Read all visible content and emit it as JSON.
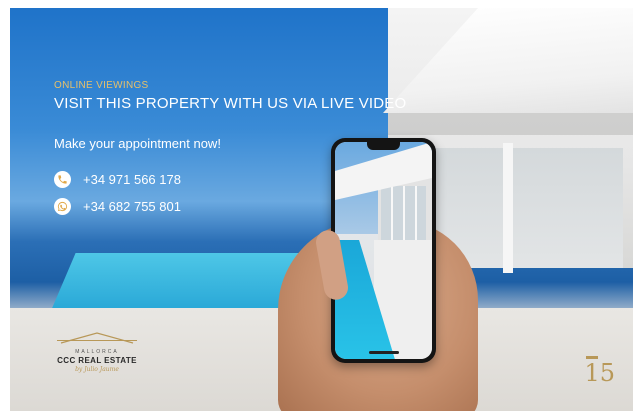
{
  "banner": {
    "eyebrow": "ONLINE VIEWINGS",
    "headline": "VISIT THIS PROPERTY WITH US VIA LIVE VIDEO",
    "cta": "Make your appointment now!",
    "phones": [
      {
        "icon": "phone-icon",
        "number": "+34 971 566 178"
      },
      {
        "icon": "whatsapp-icon",
        "number": "+34 682 755 801"
      }
    ]
  },
  "logo": {
    "top": "MALLORCA",
    "name": "CCC REAL ESTATE",
    "signature": "by Julio Jaume"
  },
  "anniversary": "15",
  "colors": {
    "gold": "#b89858",
    "eyebrow": "#e6c06a",
    "text": "#ffffff"
  }
}
